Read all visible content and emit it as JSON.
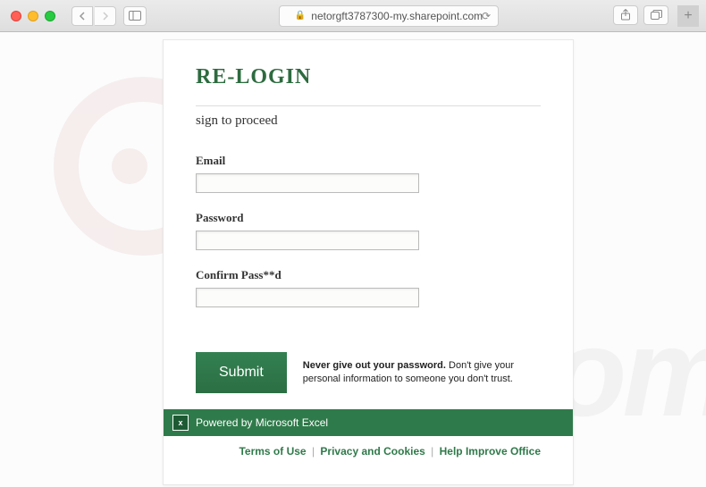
{
  "browser": {
    "url": "netorgft3787300-my.sharepoint.com"
  },
  "form": {
    "title": "RE-LOGIN",
    "subtitle": "sign to proceed",
    "fields": {
      "email": {
        "label": "Email",
        "value": ""
      },
      "password": {
        "label": "Password",
        "value": ""
      },
      "confirm": {
        "label": "Confirm Pass**d",
        "value": ""
      }
    },
    "submit_label": "Submit",
    "warning_bold": "Never give out your password.",
    "warning_rest": " Don't give your personal information to someone you don't trust."
  },
  "powered_by": "Powered by Microsoft Excel",
  "footer": {
    "terms": "Terms of Use",
    "privacy": "Privacy and Cookies",
    "help": "Help Improve Office"
  },
  "watermark": "risk.com"
}
